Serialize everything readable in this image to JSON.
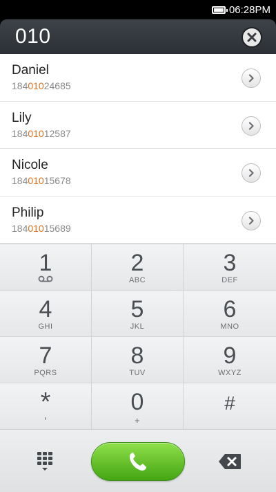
{
  "status_bar": {
    "time": "06:28PM",
    "battery_icon": "battery-icon"
  },
  "search": {
    "query": "010",
    "clear_icon": "close-icon"
  },
  "results": [
    {
      "name": "Daniel",
      "number_prefix": "184",
      "number_match": "010",
      "number_suffix": "24685"
    },
    {
      "name": "Lily",
      "number_prefix": "184",
      "number_match": "010",
      "number_suffix": "12587"
    },
    {
      "name": "Nicole",
      "number_prefix": "184",
      "number_match": "010",
      "number_suffix": "15678"
    },
    {
      "name": "Philip",
      "number_prefix": "184",
      "number_match": "010",
      "number_suffix": "15689"
    }
  ],
  "keypad": [
    {
      "digit": "1",
      "letters": "",
      "icon": "voicemail-icon"
    },
    {
      "digit": "2",
      "letters": "ABC"
    },
    {
      "digit": "3",
      "letters": "DEF"
    },
    {
      "digit": "4",
      "letters": "GHI"
    },
    {
      "digit": "5",
      "letters": "JKL"
    },
    {
      "digit": "6",
      "letters": "MNO"
    },
    {
      "digit": "7",
      "letters": "PQRS"
    },
    {
      "digit": "8",
      "letters": "TUV"
    },
    {
      "digit": "9",
      "letters": "WXYZ"
    },
    {
      "digit": "*",
      "letters": ","
    },
    {
      "digit": "0",
      "letters": "+"
    },
    {
      "digit": "#",
      "letters": ""
    }
  ],
  "bottom_bar": {
    "dialpad_icon": "dialpad-icon",
    "call_icon": "phone-icon",
    "backspace_icon": "backspace-icon"
  },
  "colors": {
    "highlight": "#e07020",
    "call_green": "#44a514",
    "header_dark": "#2c3035"
  }
}
